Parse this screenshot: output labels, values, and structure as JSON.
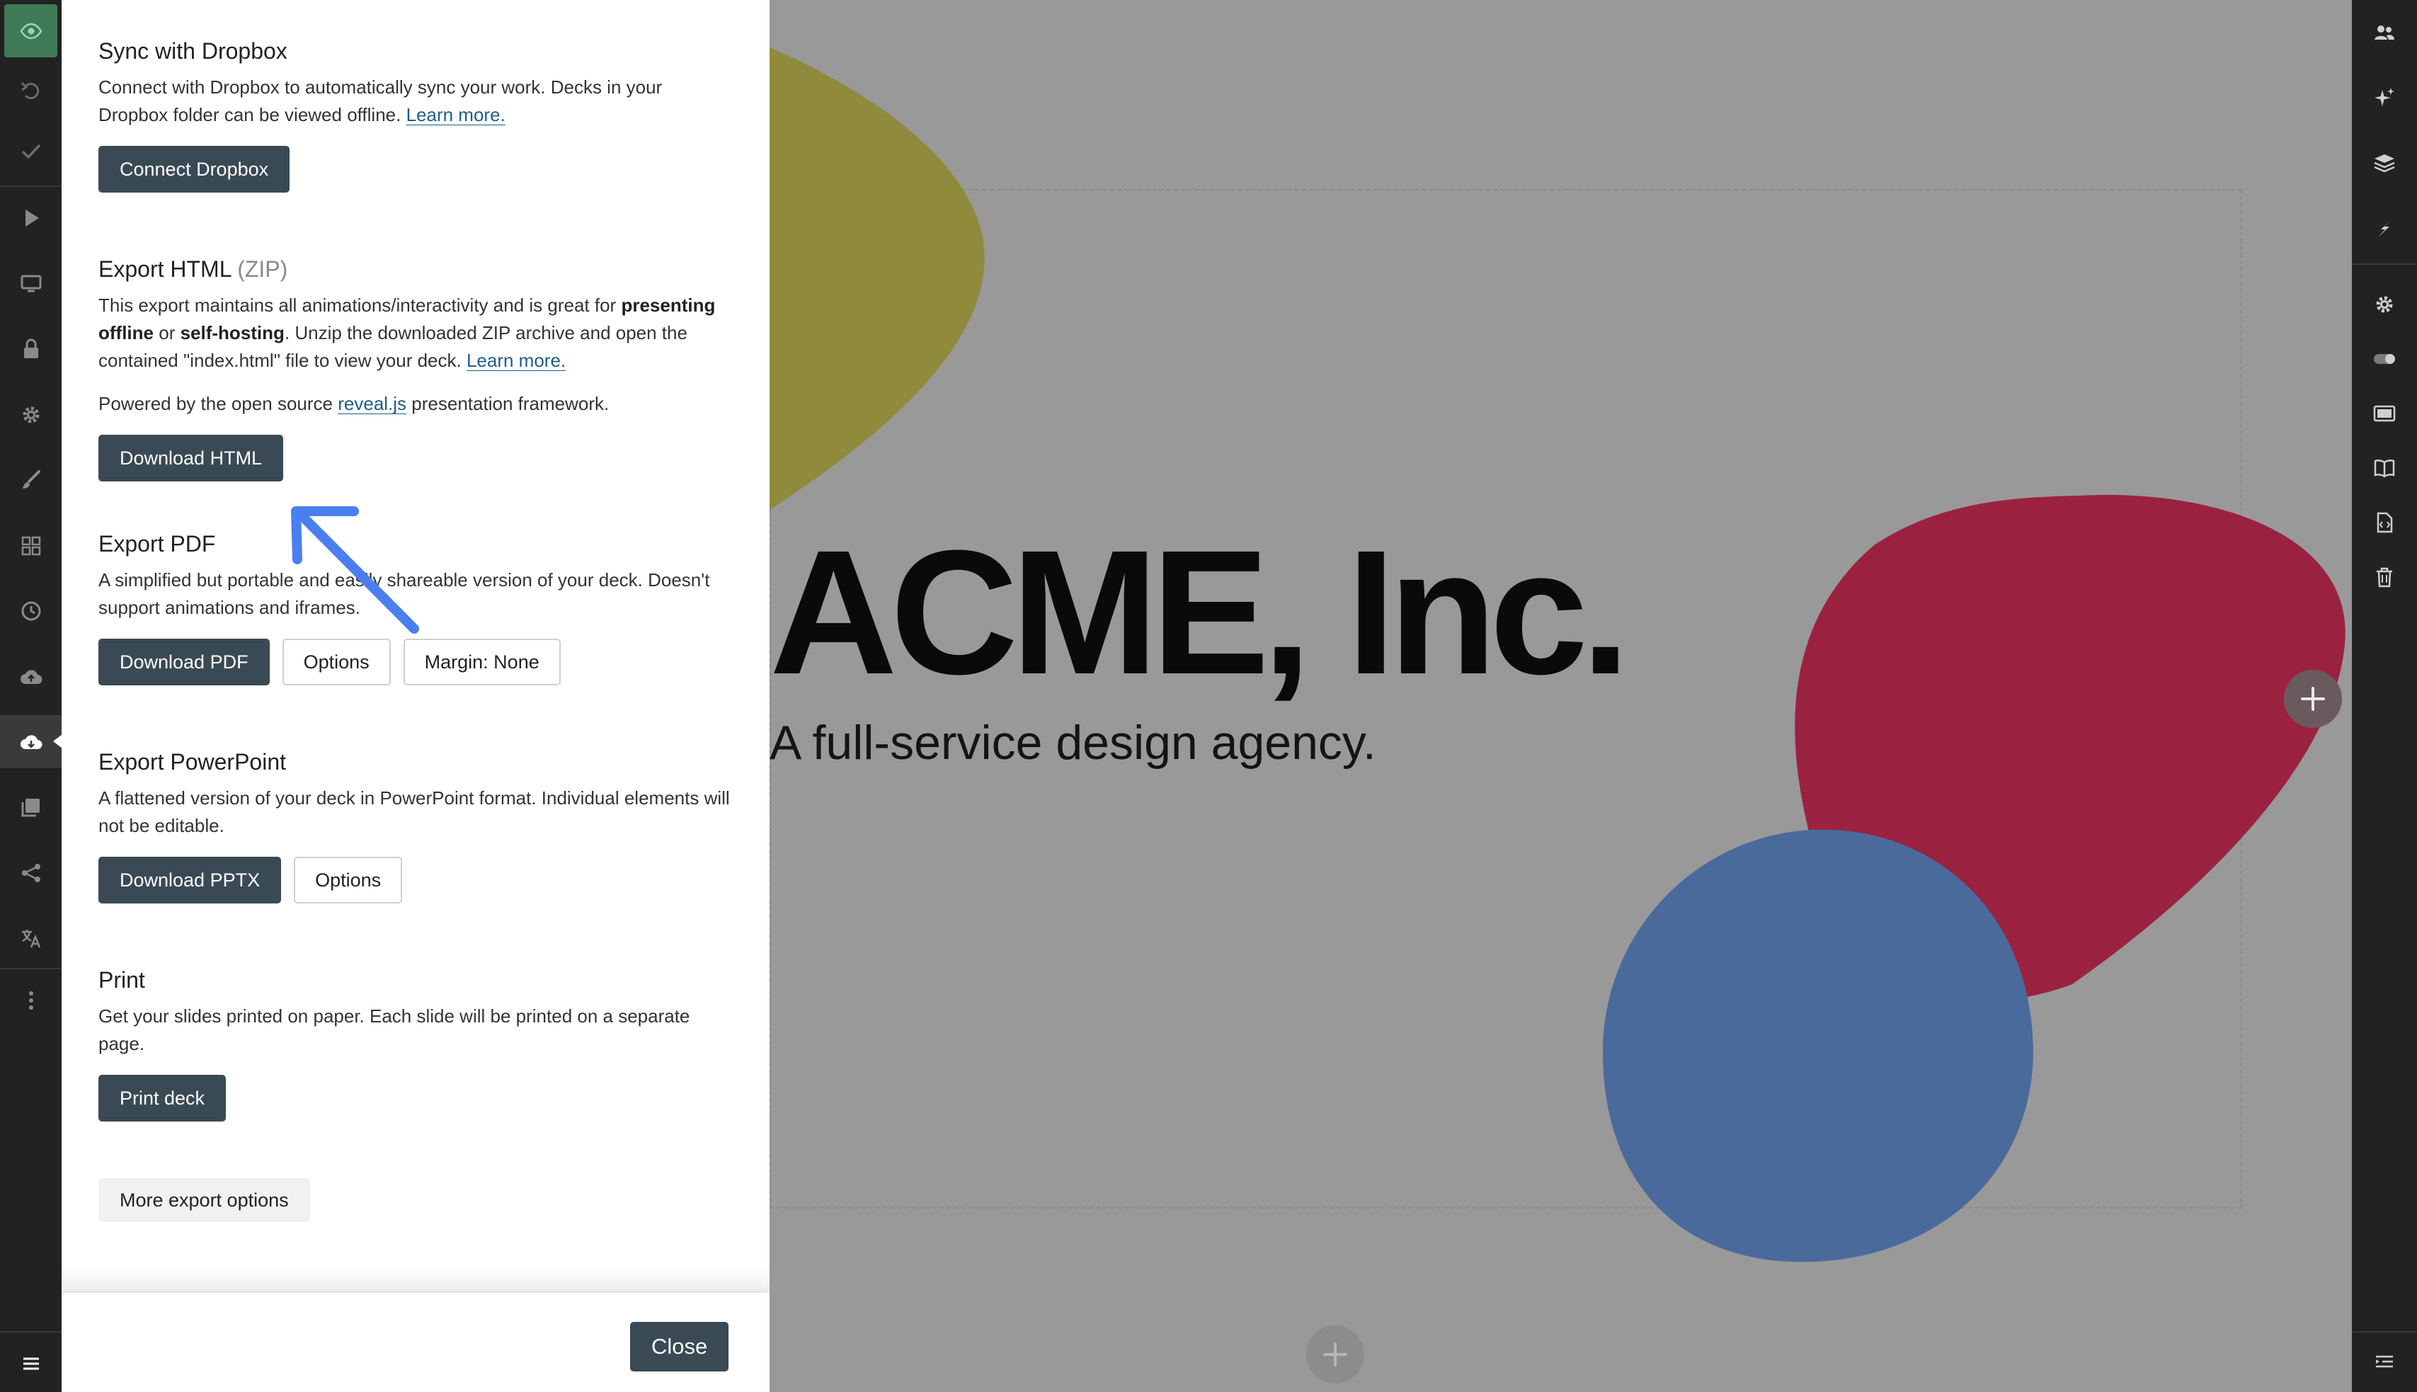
{
  "panel": {
    "sections": [
      {
        "id": "dropbox",
        "title": "Sync with Dropbox",
        "title_muted": "",
        "desc": "Connect with Dropbox to automatically sync your work. Decks in your Dropbox folder can be viewed offline.",
        "desc_link": "Learn more.",
        "buttons": [
          "Connect Dropbox"
        ]
      },
      {
        "id": "html",
        "title": "Export HTML",
        "title_muted": "(ZIP)",
        "desc_part1": "This export maintains all animations/interactivity and is great for",
        "desc_bold1": "presenting offline",
        "desc_or": "or",
        "desc_bold2": "self-hosting",
        "desc_part2": ". Unzip the downloaded ZIP archive and open the contained \"index.html\" file to view your deck.",
        "desc_link": "Learn more.",
        "powered_prefix": "Powered by the open source",
        "powered_link": "reveal.js",
        "powered_suffix": "presentation framework.",
        "buttons": [
          "Download HTML"
        ]
      },
      {
        "id": "pdf",
        "title": "Export PDF",
        "desc": "A simplified but portable and easily shareable version of your deck. Doesn't support animations and iframes.",
        "buttons": [
          "Download PDF",
          "Options",
          "Margin: None"
        ]
      },
      {
        "id": "pptx",
        "title": "Export PowerPoint",
        "desc": "A flattened version of your deck in PowerPoint format. Individual elements will not be editable.",
        "buttons": [
          "Download PPTX",
          "Options"
        ]
      },
      {
        "id": "print",
        "title": "Print",
        "desc": "Get your slides printed on paper. Each slide will be printed on a separate page.",
        "buttons": [
          "Print deck"
        ]
      }
    ],
    "more_options": "More export options",
    "close": "Close"
  },
  "slide": {
    "title": "ACME, Inc.",
    "subtitle": "A full-service design agency."
  },
  "colors": {
    "accent_green": "#3f7a57",
    "button_dark": "#3a4a55",
    "link": "#1f5d88",
    "annotation_arrow": "#4a7fef",
    "blob_yellow": "#8f8a3c",
    "blob_red": "#9a2240",
    "blob_blue": "#4a6a9c",
    "next_arrow": "#2f4e8c"
  },
  "left_toolbar": [
    "preview-icon",
    "undo-icon",
    "save-check-icon",
    "present-icon",
    "display-icon",
    "lock-icon",
    "settings-icon",
    "brush-icon",
    "grid-icon",
    "history-icon",
    "cloud-upload-icon",
    "export-icon",
    "media-icon",
    "share-icon",
    "translate-icon",
    "more-icon",
    "menu-icon"
  ],
  "right_toolbar": [
    "collaborators-icon",
    "ai-sparkle-icon",
    "layers-icon",
    "lightning-icon",
    "slide-settings-icon",
    "toggle-icon",
    "slide-layout-icon",
    "notes-icon",
    "code-icon",
    "trash-icon",
    "collapse-icon"
  ]
}
